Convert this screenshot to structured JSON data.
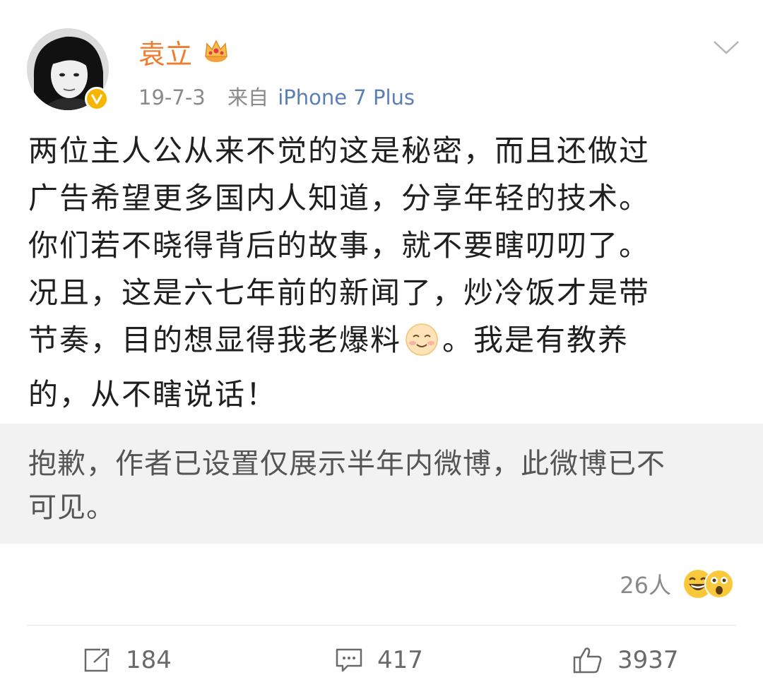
{
  "post": {
    "author": {
      "name": "袁立",
      "verified": true,
      "badge_icon": "crown-icon"
    },
    "date": "19-7-3",
    "source_prefix": "来自",
    "source_device": "iPhone 7 Plus",
    "content_lines": [
      "两位主人公从来不觉的这是秘密，而且还做过",
      "广告希望更多国内人知道，分享年轻的技术。",
      "你们若不晓得背后的故事，就不要瞎叨叨了。",
      "况且，这是六七年前的新闻了，炒冷饭才是带",
      "节奏，目的想显得我老爆料",
      "。我是有教养",
      "的，从不瞎说话！"
    ],
    "notice_lines": [
      "抱歉，作者已设置仅展示半年内微博，此微博已不",
      "可见。"
    ],
    "reactions": {
      "count_text": "26人",
      "icons": [
        "grin-emoji-icon",
        "surprised-emoji-icon"
      ]
    },
    "actions": {
      "repost_count": "184",
      "comment_count": "417",
      "like_count": "3937"
    }
  },
  "colors": {
    "username": "#ef7c2f",
    "device_link": "#5b7fb5",
    "verified_badge": "#f7b500",
    "notice_bg": "#f2f2f2"
  }
}
